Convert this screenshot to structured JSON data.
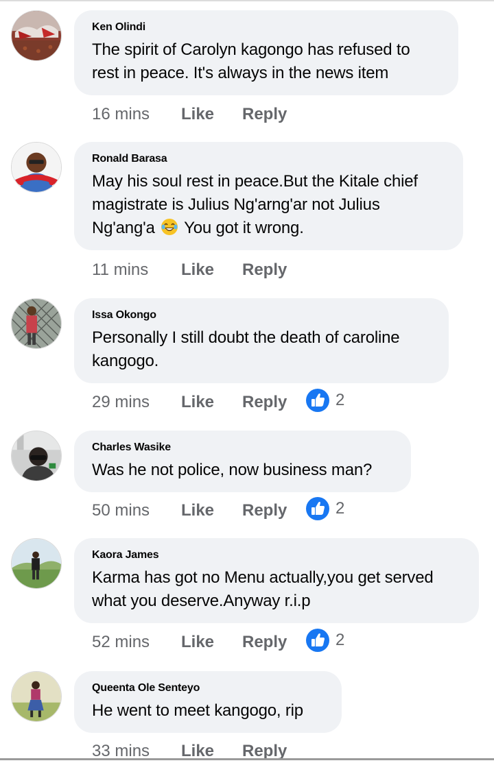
{
  "comments": [
    {
      "author": "Ken Olindi",
      "text_lines": [
        "The spirit of Carolyn kagongo has refused to",
        "rest in peace. It's always in the news item"
      ],
      "time": "16 mins",
      "like": "Like",
      "reply": "Reply",
      "reactions": null
    },
    {
      "author": "Ronald Barasa",
      "text_lines": [
        "May his soul rest in peace.But the Kitale chief",
        "magistrate is Julius Ng'arng'ar not Julius"
      ],
      "text_line3_before": "Ng'ang'a",
      "text_line3_after": "You got it wrong.",
      "emoji": "laughing-crying-emoji",
      "time": "11 mins",
      "like": "Like",
      "reply": "Reply",
      "reactions": null
    },
    {
      "author": "Issa Okongo",
      "text_lines": [
        "Personally I still doubt the death of caroline",
        "kangogo."
      ],
      "time": "29 mins",
      "like": "Like",
      "reply": "Reply",
      "reactions": "2"
    },
    {
      "author": "Charles Wasike",
      "text_lines": [
        "Was he not police, now business man?"
      ],
      "time": "50 mins",
      "like": "Like",
      "reply": "Reply",
      "reactions": "2"
    },
    {
      "author": "Kaora James",
      "text_lines": [
        "Karma has got no Menu actually,you get served",
        "what you deserve.Anyway r.i.p"
      ],
      "time": "52 mins",
      "like": "Like",
      "reply": "Reply",
      "reactions": "2"
    },
    {
      "author": "Queenta Ole Senteyo",
      "text_lines": [
        "He went to meet kangogo, rip"
      ],
      "time": "33 mins",
      "like": "Like",
      "reply": "Reply",
      "reactions": null
    }
  ],
  "colors": {
    "bubble": "#f0f2f5",
    "meta_text": "#65676b",
    "like_blue": "#1877f2"
  },
  "icons": {
    "reaction": "thumbs-up-icon"
  }
}
